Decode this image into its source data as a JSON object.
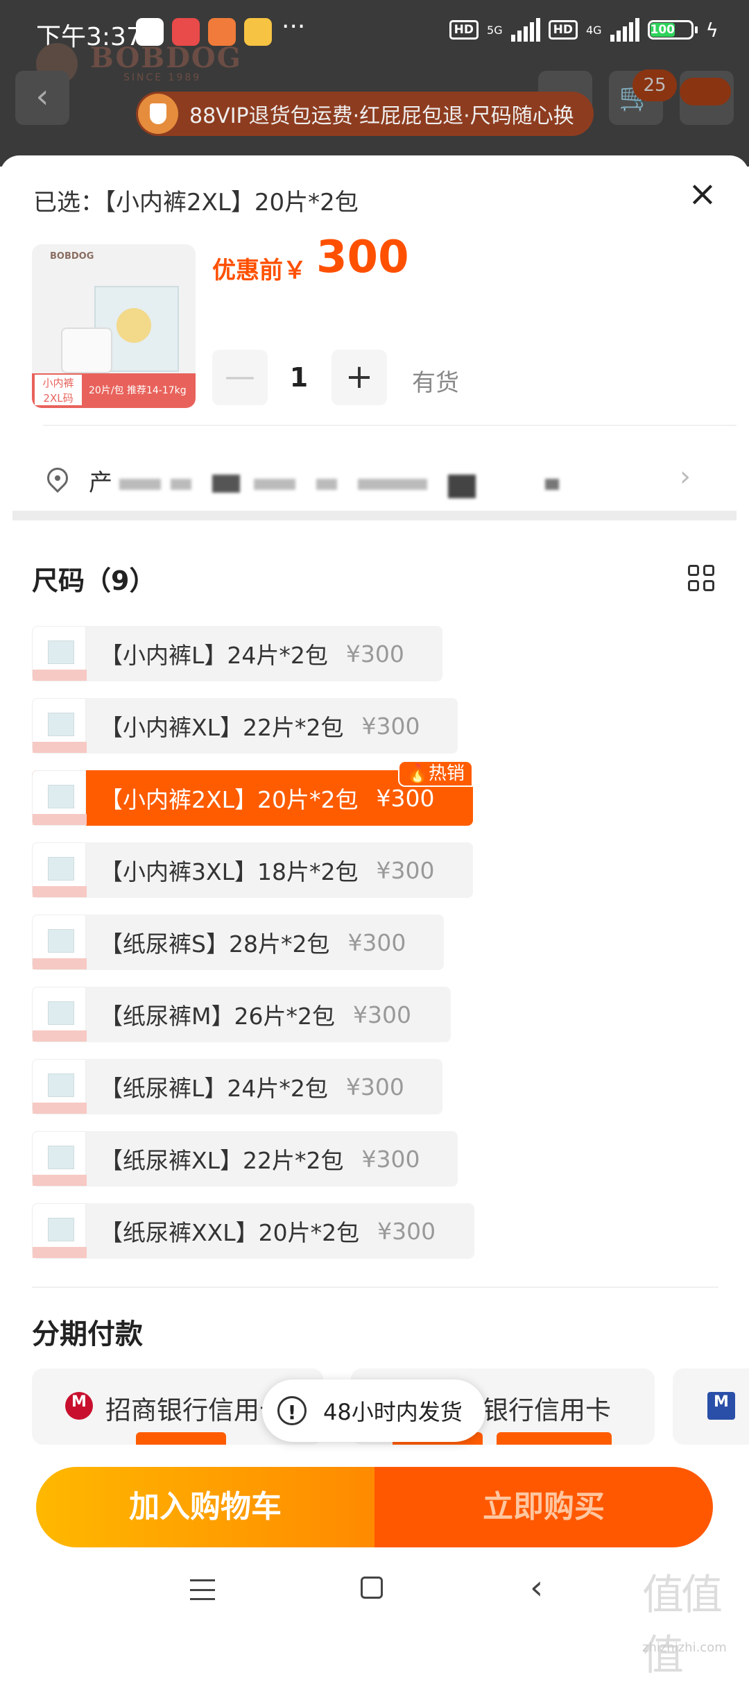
{
  "status_bar": {
    "time": "下午3:37",
    "more": "···",
    "hd1": "HD",
    "net1": "5G",
    "hd2": "HD",
    "net2": "4G",
    "battery": "100"
  },
  "background_page": {
    "brand": "BOBDOG",
    "brand_sub": "SINCE 1989",
    "cart_badge": "25",
    "vip_banner": "88VIP退货包运费·红屁屁包退·尺码随心换"
  },
  "sheet": {
    "selected_label": "已选：【小内裤2XL】20片*2包",
    "close_icon": "×",
    "thumb": {
      "brand": "BOBDOG",
      "size_tag_line1": "小内裤",
      "size_tag_line2": "2XL码",
      "info": "20片/包 推荐14-17kg"
    },
    "price_label": "优惠前￥",
    "price_value": "300",
    "quantity": {
      "minus": "—",
      "value": "1",
      "plus": "+"
    },
    "stock": "有货",
    "address": {
      "first_char": "产",
      "arrow": "›"
    },
    "size_section": {
      "title": "尺码（9）",
      "items": [
        {
          "name": "【小内裤L】24片*2包",
          "price": "¥300",
          "active": false
        },
        {
          "name": "【小内裤XL】22片*2包",
          "price": "¥300",
          "active": false
        },
        {
          "name": "【小内裤2XL】20片*2包",
          "price": "¥300",
          "active": true,
          "tag": "🔥热销"
        },
        {
          "name": "【小内裤3XL】18片*2包",
          "price": "¥300",
          "active": false
        },
        {
          "name": "【纸尿裤S】28片*2包",
          "price": "¥300",
          "active": false
        },
        {
          "name": "【纸尿裤M】26片*2包",
          "price": "¥300",
          "active": false
        },
        {
          "name": "【纸尿裤L】24片*2包",
          "price": "¥300",
          "active": false
        },
        {
          "name": "【纸尿裤XL】22片*2包",
          "price": "¥300",
          "active": false
        },
        {
          "name": "【纸尿裤XXL】20片*2包",
          "price": "¥300",
          "active": false
        }
      ]
    },
    "installment": {
      "title": "分期付款",
      "bank1": "招商银行信用卡",
      "bank2": "银行信用卡"
    },
    "toast": {
      "icon": "!",
      "text": "48小时内发货"
    },
    "actions": {
      "add_to_cart": "加入购物车",
      "buy_now": "立即购买"
    }
  },
  "nav": {
    "back": "‹"
  },
  "watermark": {
    "text": "值值值",
    "url": "zhizhizhi.com"
  },
  "colors": {
    "accent": "#ff5000",
    "active_bg": "#ff5c00",
    "cart_btn": "#ffa800"
  }
}
